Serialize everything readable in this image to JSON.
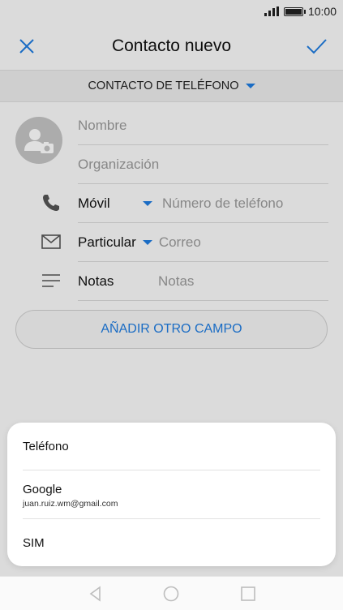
{
  "status_bar": {
    "time": "10:00"
  },
  "app_bar": {
    "title": "Contacto nuevo"
  },
  "account": {
    "label": "CONTACTO DE TELÉFONO"
  },
  "form": {
    "name_placeholder": "Nombre",
    "organization_placeholder": "Organización",
    "phone_type": "Móvil",
    "phone_placeholder": "Número de teléfono",
    "email_type": "Particular",
    "email_placeholder": "Correo",
    "notes_label": "Notas",
    "notes_placeholder": "Notas",
    "add_field_label": "AÑADIR OTRO CAMPO"
  },
  "account_sheet": {
    "options": [
      {
        "title": "Teléfono"
      },
      {
        "title": "Google",
        "subtitle": "juan.ruiz.wm@gmail.com"
      },
      {
        "title": "SIM"
      }
    ]
  },
  "colors": {
    "accent": "#1e7be0",
    "avatar": "#c4c4c4"
  }
}
